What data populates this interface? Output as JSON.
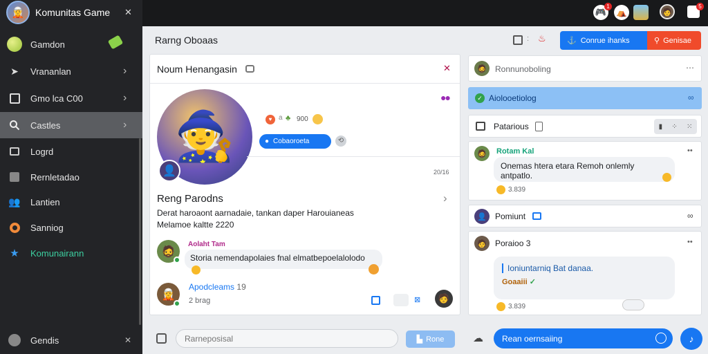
{
  "app": {
    "title": "Komunitas Game",
    "close": "✕"
  },
  "sidebar": {
    "items": [
      {
        "label": "Gamdon",
        "icon": "globe-icon",
        "chev": "tag"
      },
      {
        "label": "Vrananlan",
        "icon": "send-icon",
        "chev": "›"
      },
      {
        "label": "Gmo lca C00",
        "icon": "book-icon",
        "chev": "›"
      },
      {
        "label": "Castles",
        "icon": "search-icon",
        "chev": "›"
      },
      {
        "label": "Logrd",
        "icon": "image-icon",
        "chev": ""
      },
      {
        "label": "Rernletadao",
        "icon": "chart-icon",
        "chev": ""
      },
      {
        "label": "Lantien",
        "icon": "people-icon",
        "chev": ""
      },
      {
        "label": "Sanniog",
        "icon": "settings-icon",
        "chev": ""
      },
      {
        "label": "Komunairann",
        "icon": "star-icon",
        "chev": ""
      }
    ],
    "footer": {
      "label": "Gendis",
      "close": "✕"
    }
  },
  "topbar": {
    "badge": "1",
    "badge2": "5"
  },
  "header": {
    "title": "Rarng Oboaas",
    "btn_primary": "Conrue ihanks",
    "btn_secondary": "Genisae"
  },
  "post": {
    "card_title": "Noum Henangasin",
    "reaction_count": "900",
    "pill": "Cobaoroeta",
    "time": "20/16",
    "name": "Reng Parodns",
    "desc1": "Derat haroaont aarnadaie, tankan daper Harouianeas",
    "desc2": "Melamoe kaltte 2220",
    "comments": [
      {
        "author": "Aolaht Tam",
        "text": "Storia nemendapolaies fnal elmatbepoelalolodo"
      },
      {
        "author": "Apodcleams",
        "count": "19",
        "sub": "2 brag"
      }
    ]
  },
  "right": {
    "chat_title": "Ronnunoboling",
    "active_item": "Aiolooetiolog",
    "section": "Patarious",
    "thread1": {
      "author": "Rotam Kal",
      "text": "Onemas htera etara Remoh onlemly antpatlo.",
      "reactions": "3.839"
    },
    "pinned": "Pomiunt",
    "thread2": {
      "author": "Poraioo",
      "count": "3",
      "line1": "Ioniuntarniq Bat danaa.",
      "line2": "Goaaiii",
      "reactions": "3.839"
    }
  },
  "composer": {
    "placeholder": "Rarneposisal",
    "send": "Rone"
  },
  "reply": {
    "placeholder": "Rean oernsaiing"
  }
}
